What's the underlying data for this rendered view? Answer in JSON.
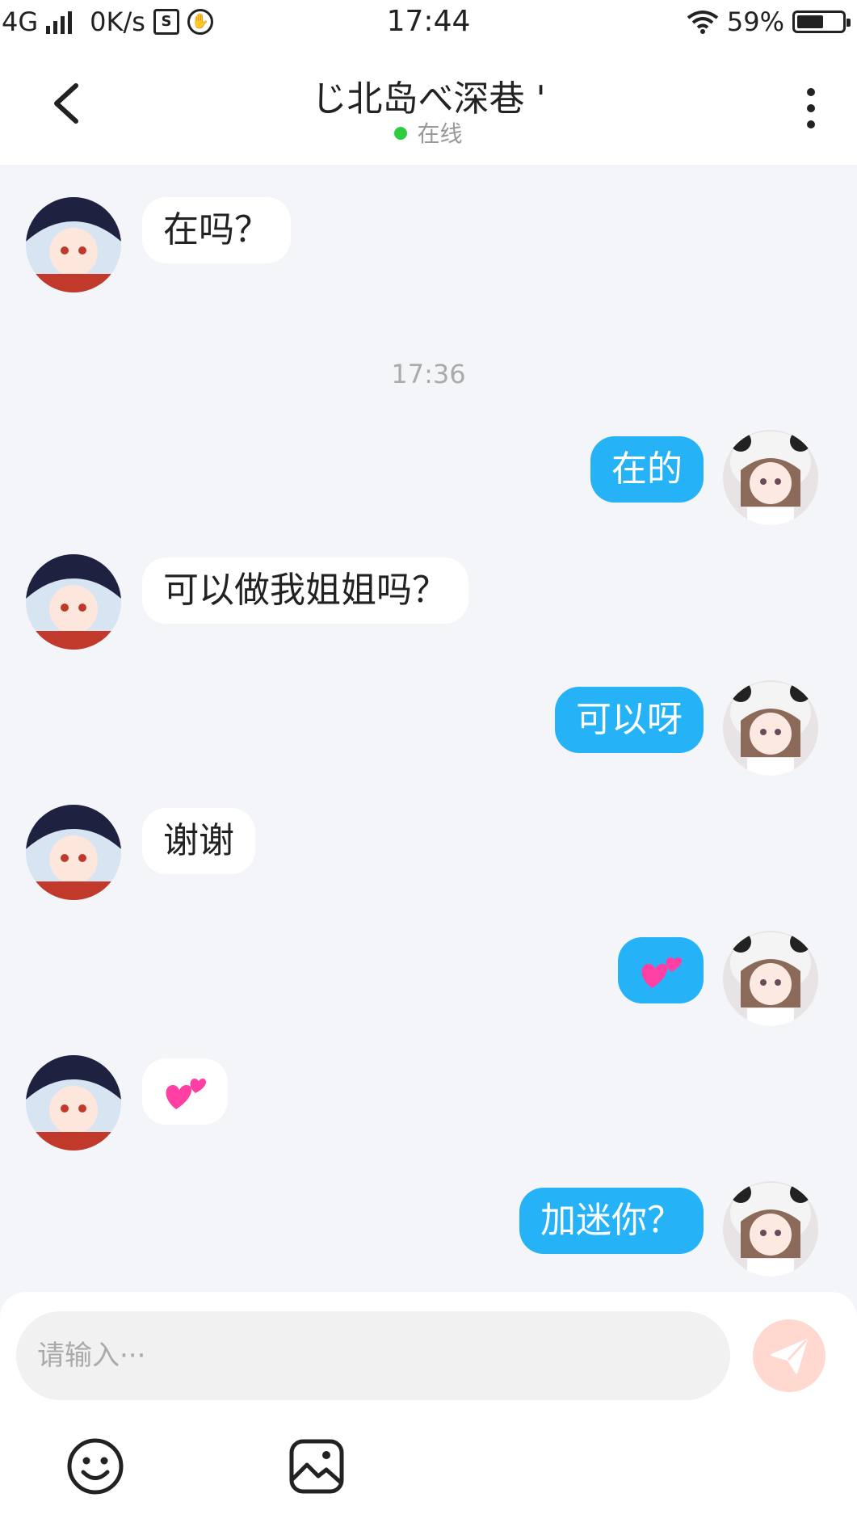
{
  "status_bar": {
    "network": "4G",
    "speed": "0K/s",
    "time": "17:44",
    "battery": "59%",
    "battery_level": 0.59
  },
  "header": {
    "title": "じ北岛べ深巷 '",
    "presence": "在线",
    "presence_color": "#2ecc40",
    "back_icon": "chevron-left-icon",
    "more_icon": "vertical-dots-icon"
  },
  "messages": [
    {
      "side": "in",
      "text": "在吗？"
    },
    {
      "side": "time",
      "text": "17:36"
    },
    {
      "side": "out",
      "text": "在的"
    },
    {
      "side": "in",
      "text": "可以做我姐姐吗？"
    },
    {
      "side": "out",
      "text": "可以呀"
    },
    {
      "side": "in",
      "text": "谢谢"
    },
    {
      "side": "out",
      "emoji": "two-hearts-icon"
    },
    {
      "side": "in",
      "emoji": "two-hearts-icon"
    },
    {
      "side": "out",
      "text": "加迷你？"
    }
  ],
  "composer": {
    "placeholder": "请输入···",
    "send_icon": "paper-plane-icon",
    "tools": [
      "smiley-icon",
      "image-icon"
    ]
  },
  "colors": {
    "outgoing_bubble": "#26b2f7",
    "incoming_bubble": "#ffffff",
    "background": "#f3f5f8",
    "send_button": "#ffd9d0"
  }
}
